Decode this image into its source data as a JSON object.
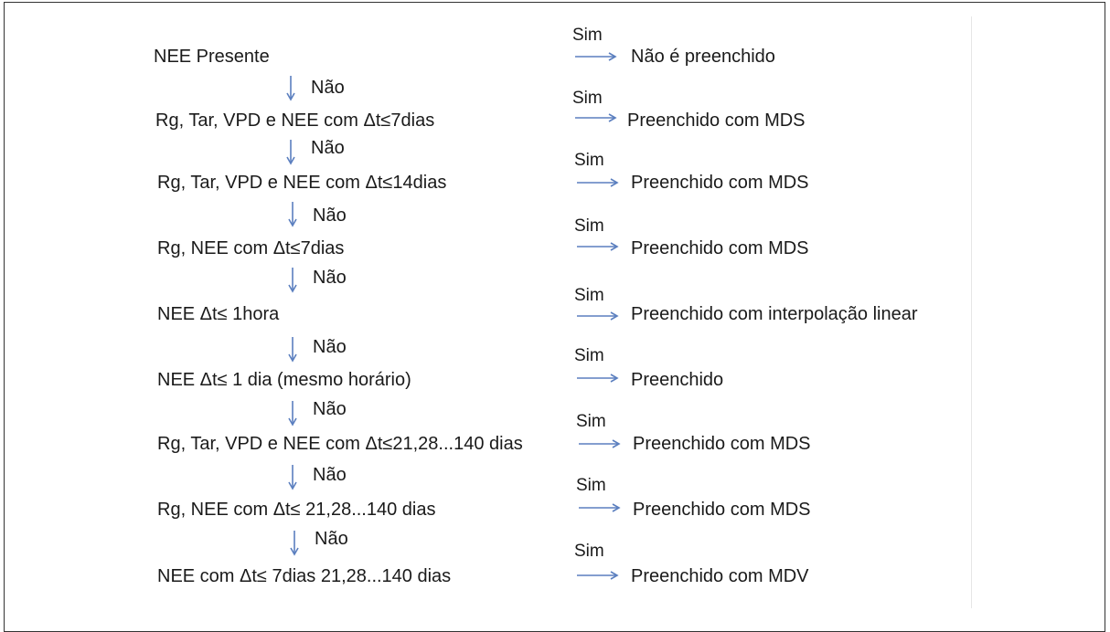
{
  "yes_label": "Sim",
  "no_label": "Não",
  "arrow_color": "#5b7fbf",
  "steps": [
    {
      "condition": "NEE Presente",
      "result": "Não é preenchido"
    },
    {
      "condition": "Rg, Tar, VPD e NEE com Δt≤7dias",
      "result": "Preenchido com MDS"
    },
    {
      "condition": "Rg, Tar, VPD e NEE com Δt≤14dias",
      "result": "Preenchido com MDS"
    },
    {
      "condition": "Rg, NEE com Δt≤7dias",
      "result": "Preenchido com MDS"
    },
    {
      "condition": "NEE Δt≤ 1hora",
      "result": "Preenchido com interpolação linear"
    },
    {
      "condition": "NEE Δt≤ 1 dia (mesmo horário)",
      "result": "Preenchido"
    },
    {
      "condition": "Rg, Tar, VPD e NEE com Δt≤21,28...140 dias",
      "result": "Preenchido com MDS"
    },
    {
      "condition": "Rg, NEE com Δt≤ 21,28...140 dias",
      "result": "Preenchido com MDS"
    },
    {
      "condition": "NEE com Δt≤ 7dias 21,28...140 dias",
      "result": "Preenchido com MDV"
    }
  ]
}
